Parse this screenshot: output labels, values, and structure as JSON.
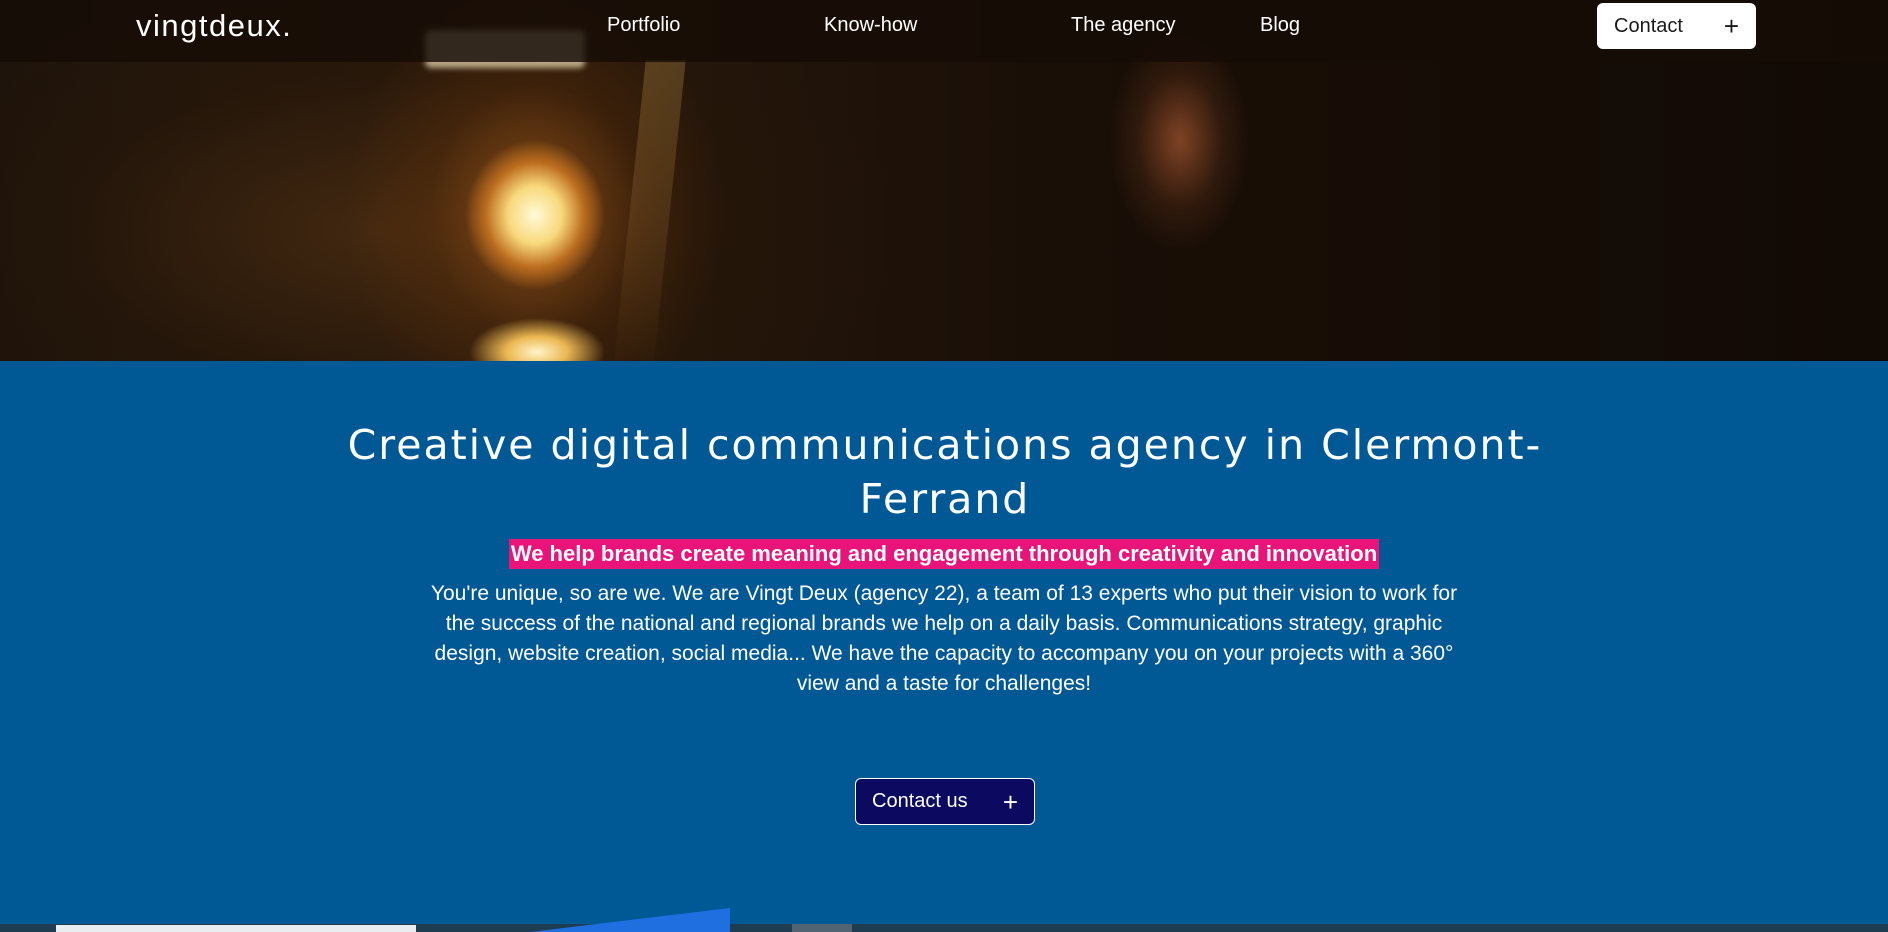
{
  "navbar": {
    "logo": "vingtdeux.",
    "links": [
      {
        "label": "Portfolio"
      },
      {
        "label": "Know-how"
      },
      {
        "label": "The agency"
      },
      {
        "label": "Blog"
      }
    ],
    "contact_label": "Contact",
    "contact_icon": "plus-icon"
  },
  "main": {
    "title": "Creative digital communications agency in Clermont-Ferrand",
    "tagline": "We help brands create meaning and engagement through creativity and innovation",
    "description": "You're unique, so are we. We are Vingt Deux (agency 22), a team of 13 experts who put their vision to work for the success of the national and regional brands we help on a daily basis. Communications strategy, graphic design, website creation, social media... We have the capacity to accompany you on your projects with a 360° view and a taste for challenges!",
    "cta_label": "Contact us",
    "cta_icon": "plus-icon"
  },
  "colors": {
    "section_background": "#005895",
    "tagline_highlight": "#e8147a",
    "cta_background": "#0c0960",
    "navbar_background": "#160c06"
  }
}
